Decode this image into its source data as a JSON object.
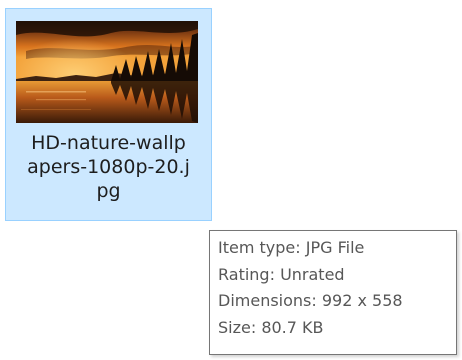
{
  "file": {
    "icon": "image-thumbnail",
    "name_lines": [
      "HD-nature-wallp",
      "apers-1080p-20.j",
      "pg"
    ],
    "selected": true
  },
  "tooltip": {
    "lines": [
      "Item type: JPG File",
      "Rating: Unrated",
      "Dimensions: 992 x 558",
      "Size: 80.7 KB"
    ]
  },
  "colors": {
    "selection_background": "#cce8ff",
    "selection_border": "#99d1ff",
    "tooltip_border": "#767676",
    "tooltip_text": "#575757"
  }
}
